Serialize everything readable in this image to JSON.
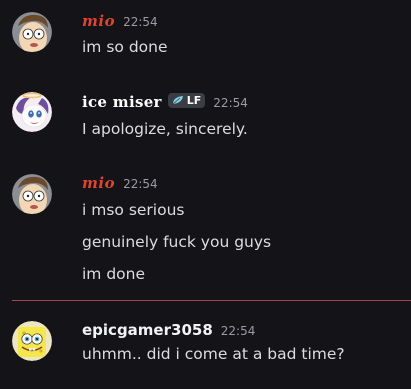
{
  "messages": [
    {
      "author": "mio",
      "time": "22:54",
      "avatar": "morty-avatar",
      "lines": [
        "im so done"
      ]
    },
    {
      "author": "ice miser",
      "time": "22:54",
      "avatar": "pony-avatar",
      "tag": {
        "icon": "leaf-icon",
        "label": "LF"
      },
      "lines": [
        "I apologize, sincerely."
      ]
    },
    {
      "author": "mio",
      "time": "22:54",
      "avatar": "morty-avatar",
      "lines": [
        "i mso serious",
        "genuinely fuck you guys",
        "im done"
      ]
    },
    {
      "author": "epicgamer3058",
      "time": "22:54",
      "avatar": "spongebob-avatar",
      "lines": [
        "uhmm.. did i come at a bad time?"
      ]
    }
  ],
  "colors": {
    "background": "#141318",
    "mio_name": "#e0442f",
    "divider": "#a84550",
    "tag_bg": "#3b3d44"
  }
}
